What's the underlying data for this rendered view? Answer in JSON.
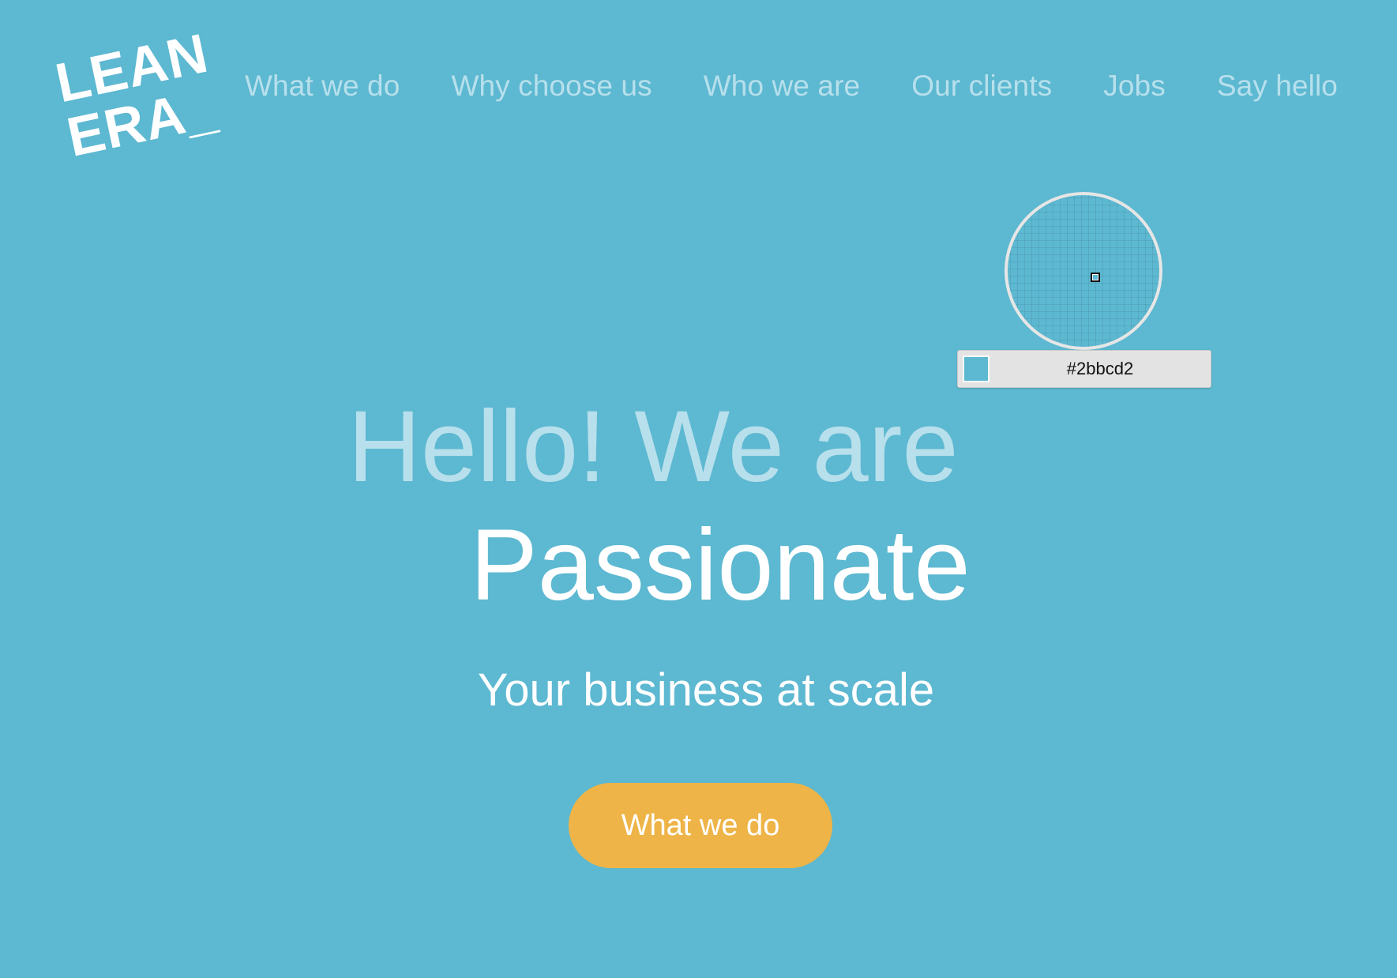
{
  "brand": {
    "logo_line1": "LEAN",
    "logo_line2": "ERA_"
  },
  "nav": {
    "items": [
      {
        "label": "What we do"
      },
      {
        "label": "Why choose us"
      },
      {
        "label": "Who we are"
      },
      {
        "label": "Our clients"
      },
      {
        "label": "Jobs"
      },
      {
        "label": "Say hello"
      }
    ]
  },
  "hero": {
    "line1": "Hello! We are",
    "line2": "Passionate",
    "subtitle": "Your business at scale",
    "cta_label": "What we do"
  },
  "color_picker": {
    "hex": "#2bbcd2",
    "swatch_color": "#5db8d1"
  },
  "colors": {
    "background": "#5db8d1",
    "nav_text": "#b7e0ec",
    "cta": "#eeb447"
  }
}
